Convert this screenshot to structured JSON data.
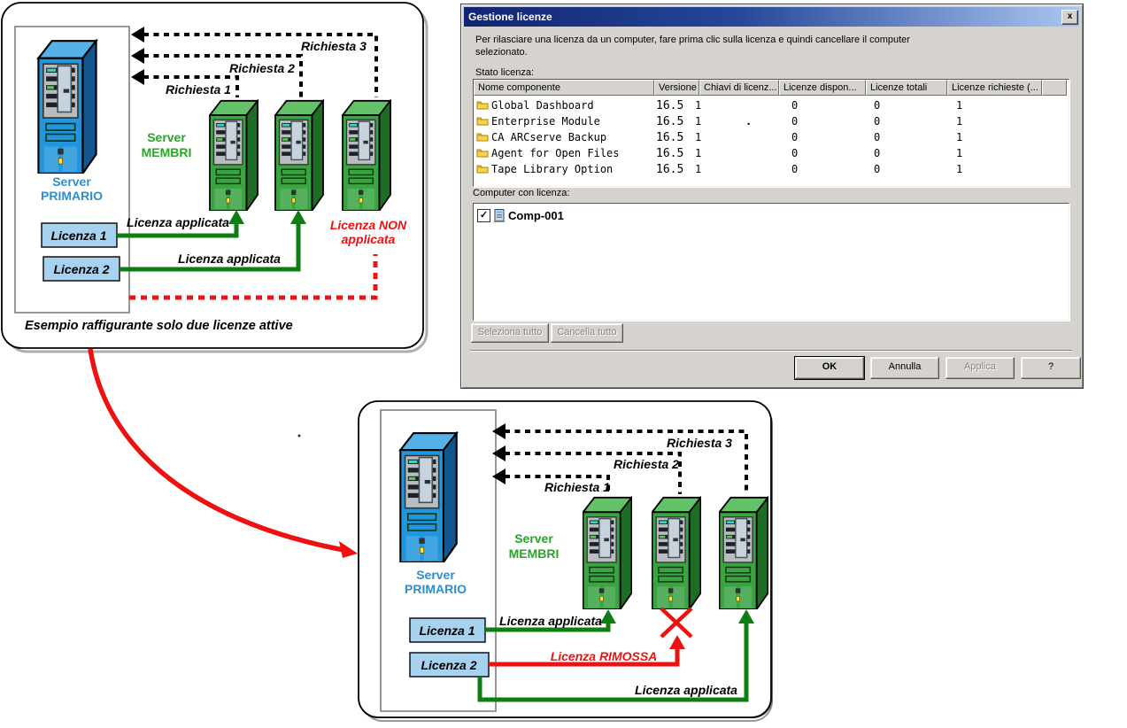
{
  "colors": {
    "accent_red": "#ee1111",
    "arrow_green": "#0e7d12",
    "label_green": "#2ba32b",
    "label_blue": "#2a90d0",
    "titlebar_left": "#102573",
    "titlebar_right": "#a9c7f0",
    "license_box_fill": "#a6d2ef",
    "dialog_bg": "#d6d3ce"
  },
  "icons": {
    "close_glyph": "x",
    "check_glyph": "✓"
  },
  "dialog": {
    "title": "Gestione licenze",
    "intro_line1": "Per rilasciare una licenza da un computer, fare prima clic sulla licenza e quindi cancellare il computer",
    "intro_line2": "selezionato.",
    "status_label": "Stato licenza:",
    "table": {
      "headers": [
        "Nome componente",
        "Versione",
        "Chiavi di licenz...",
        "Licenze dispon...",
        "Licenze totali",
        "Licenze richieste (..."
      ],
      "stray_dot": ".",
      "rows": [
        {
          "name": "Global Dashboard",
          "version": "16.5",
          "keys": "1",
          "available": "0",
          "total": "0",
          "required": "1"
        },
        {
          "name": "Enterprise Module",
          "version": "16.5",
          "keys": "1",
          "available": "0",
          "total": "0",
          "required": "1"
        },
        {
          "name": "CA ARCserve Backup",
          "version": "16.5",
          "keys": "1",
          "available": "0",
          "total": "0",
          "required": "1"
        },
        {
          "name": "Agent for Open Files",
          "version": "16.5",
          "keys": "1",
          "available": "0",
          "total": "0",
          "required": "1"
        },
        {
          "name": "Tape Library Option",
          "version": "16.5",
          "keys": "1",
          "available": "0",
          "total": "0",
          "required": "1"
        }
      ]
    },
    "computers_label": "Computer con licenza:",
    "computer": {
      "name": "Comp-001",
      "checked": true
    },
    "buttons": {
      "select_all": "Seleziona tutto",
      "clear_all": "Cancella tutto",
      "ok": "OK",
      "cancel": "Annulla",
      "apply": "Applica",
      "help": "?"
    }
  },
  "diagram_top": {
    "request_1": "Richiesta 1",
    "request_2": "Richiesta 2",
    "request_3": "Richiesta 3",
    "member_label_1": "Server",
    "member_label_2": "MEMBRI",
    "primary_label_1": "Server",
    "primary_label_2": "PRIMARIO",
    "license_1": "Licenza 1",
    "license_2": "Licenza 2",
    "applied_1": "Licenza applicata",
    "applied_2": "Licenza applicata",
    "not_applied_1": "Licenza NON",
    "not_applied_2": "applicata",
    "caption": "Esempio raffigurante solo due licenze attive"
  },
  "diagram_bottom": {
    "request_1": "Richiesta 1",
    "request_2": "Richiesta 2",
    "request_3": "Richiesta 3",
    "member_label_1": "Server",
    "member_label_2": "MEMBRI",
    "primary_label_1": "Server",
    "primary_label_2": "PRIMARIO",
    "license_1": "Licenza 1",
    "license_2": "Licenza 2",
    "applied_1": "Licenza applicata",
    "applied_2": "Licenza applicata",
    "removed": "Licenza RIMOSSA"
  }
}
